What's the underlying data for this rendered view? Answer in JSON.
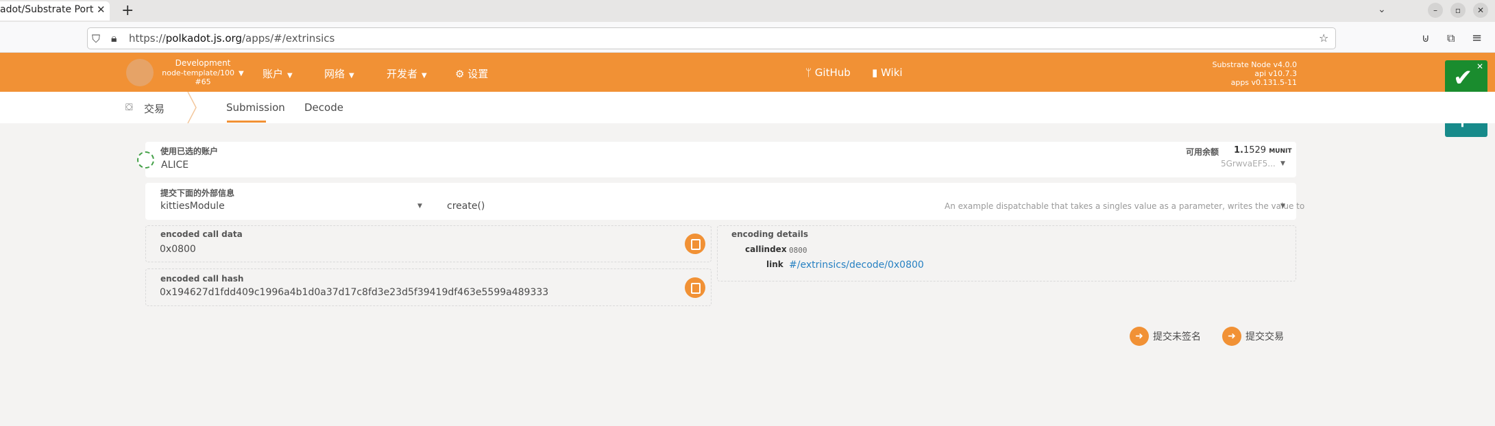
{
  "browser": {
    "tab_title": "adot/Substrate Port",
    "tab_close": "✕",
    "new_tab": "+",
    "url_scheme": "https://",
    "url_domain": "polkadot.js.org",
    "url_path": "/apps/#/extrinsics"
  },
  "header": {
    "chain_name": "Development",
    "chain_runtime": "node-template/100",
    "block": "#65",
    "menus": [
      {
        "label": "账户"
      },
      {
        "label": "网络"
      },
      {
        "label": "开发者"
      },
      {
        "label": "设置"
      }
    ],
    "links": [
      {
        "label": "GitHub"
      },
      {
        "label": "Wiki"
      }
    ],
    "versions": [
      "Substrate Node v4.0.0",
      "api v10.7.3",
      "apps v0.131.5-11"
    ]
  },
  "subnav": {
    "section": "交易",
    "tabs": [
      {
        "label": "Submission",
        "active": true
      },
      {
        "label": "Decode",
        "active": false
      }
    ]
  },
  "account": {
    "label": "使用已选的账户",
    "name": "ALICE",
    "balance_label": "可用余额",
    "balance_int": "1.",
    "balance_dec": "1529",
    "balance_unit": "MUNIT",
    "address": "5GrwvaEF5..."
  },
  "extrinsic": {
    "label": "提交下面的外部信息",
    "module": "kittiesModule",
    "call": "create()",
    "description": "An example dispatchable that takes a singles value as a parameter, writes the value to"
  },
  "encoded": {
    "call_data_label": "encoded call data",
    "call_data": "0x0800",
    "call_hash_label": "encoded call hash",
    "call_hash": "0x194627d1fdd409c1996a4b1d0a37d17c8fd3e23d5f39419df463e5599a489333"
  },
  "details": {
    "title": "encoding details",
    "callindex_label": "callindex",
    "callindex": "0800",
    "link_label": "link",
    "link": "#/extrinsics/decode/0x0800"
  },
  "actions": {
    "unsigned": "提交未签名",
    "submit": "提交交易"
  },
  "colors": {
    "accent": "#f19135",
    "notif_success": "#1a8c2e",
    "notif_info": "#178a8a"
  }
}
